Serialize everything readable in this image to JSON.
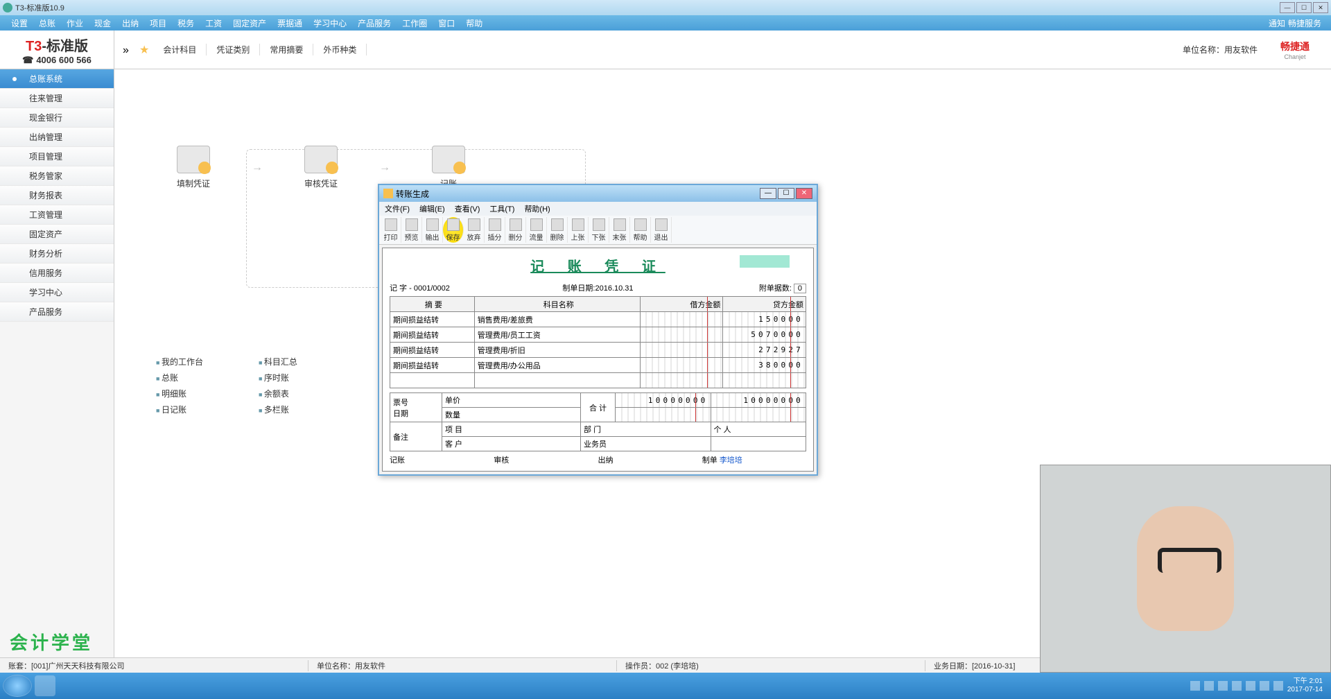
{
  "window": {
    "title": "T3-标准版10.9"
  },
  "menubar": {
    "items": [
      "设置",
      "总账",
      "作业",
      "现金",
      "出纳",
      "项目",
      "税务",
      "工资",
      "固定资产",
      "票据通",
      "学习中心",
      "产品服务",
      "工作圈",
      "窗口",
      "帮助"
    ],
    "right": {
      "notice": "通知",
      "service": "畅捷服务"
    }
  },
  "toolbar2": {
    "tabs": [
      "会计科目",
      "凭证类别",
      "常用摘要",
      "外币种类"
    ],
    "unit_label": "单位名称：",
    "unit_value": "用友软件",
    "brand": "畅捷通",
    "brand_en": "Chanjet"
  },
  "logo": {
    "t3": "T3",
    "std": "-标准版",
    "phone": "4006 600 566"
  },
  "sidebar": {
    "items": [
      "总账系统",
      "往来管理",
      "现金银行",
      "出纳管理",
      "项目管理",
      "税务管家",
      "财务报表",
      "工资管理",
      "固定资产",
      "财务分析",
      "信用服务",
      "学习中心",
      "产品服务"
    ]
  },
  "flow": {
    "items": [
      "填制凭证",
      "审核凭证",
      "记账"
    ]
  },
  "linkcols": {
    "col1": [
      "我的工作台",
      "总账",
      "明细账",
      "日记账"
    ],
    "col2": [
      "科目汇总",
      "序时账",
      "余额表",
      "多栏账"
    ]
  },
  "dialog": {
    "title": "转账生成",
    "menu": [
      "文件(F)",
      "编辑(E)",
      "查看(V)",
      "工具(T)",
      "帮助(H)"
    ],
    "toolbar": [
      "打印",
      "预览",
      "输出",
      "保存",
      "放弃",
      "插分",
      "删分",
      "流量",
      "删除",
      "上张",
      "下张",
      "末张",
      "帮助",
      "退出"
    ],
    "voucher_title": "记 账 凭 证",
    "meta": {
      "left_label": "记         字",
      "no_prefix": "-",
      "no": "0001/0002",
      "date_label": "制单日期:",
      "date": "2016.10.31",
      "attach_label": "附单据数:",
      "attach": "0"
    },
    "headers": {
      "summary": "摘 要",
      "subject": "科目名称",
      "debit": "借方金额",
      "credit": "贷方金额"
    },
    "rows": [
      {
        "summary": "期间损益结转",
        "subject": "销售费用/差旅费",
        "debit": "",
        "credit": "150000"
      },
      {
        "summary": "期间损益结转",
        "subject": "管理费用/员工工资",
        "debit": "",
        "credit": "5070000"
      },
      {
        "summary": "期间损益结转",
        "subject": "管理费用/折旧",
        "debit": "",
        "credit": "272927"
      },
      {
        "summary": "期间损益结转",
        "subject": "管理费用/办公用品",
        "debit": "",
        "credit": "380000"
      },
      {
        "summary": "",
        "subject": "",
        "debit": "",
        "credit": ""
      }
    ],
    "footer": {
      "ticket": "票号",
      "date": "日期",
      "price": "单价",
      "qty": "数量",
      "total_label": "合 计",
      "total_debit": "10000000",
      "total_credit": "10000000",
      "remark": "备注",
      "project": "项 目",
      "customer": "客 户",
      "dept": "部 门",
      "person": "个 人",
      "sales": "业务员"
    },
    "sig": {
      "book": "记账",
      "audit": "审核",
      "cashier": "出纳",
      "maker": "制单",
      "maker_name": "李培培"
    }
  },
  "statusbar": {
    "acct": "账套：[001]广州天天科技有限公司",
    "unit": "单位名称：用友软件",
    "operator": "操作员：002 (李培培)",
    "bizdate": "业务日期：[2016-10-31]",
    "time": "下午 2:01"
  },
  "taskbar": {
    "clock_time": "下午 2:01",
    "clock_date": "2017-07-14"
  },
  "kjxt": "会计学堂"
}
